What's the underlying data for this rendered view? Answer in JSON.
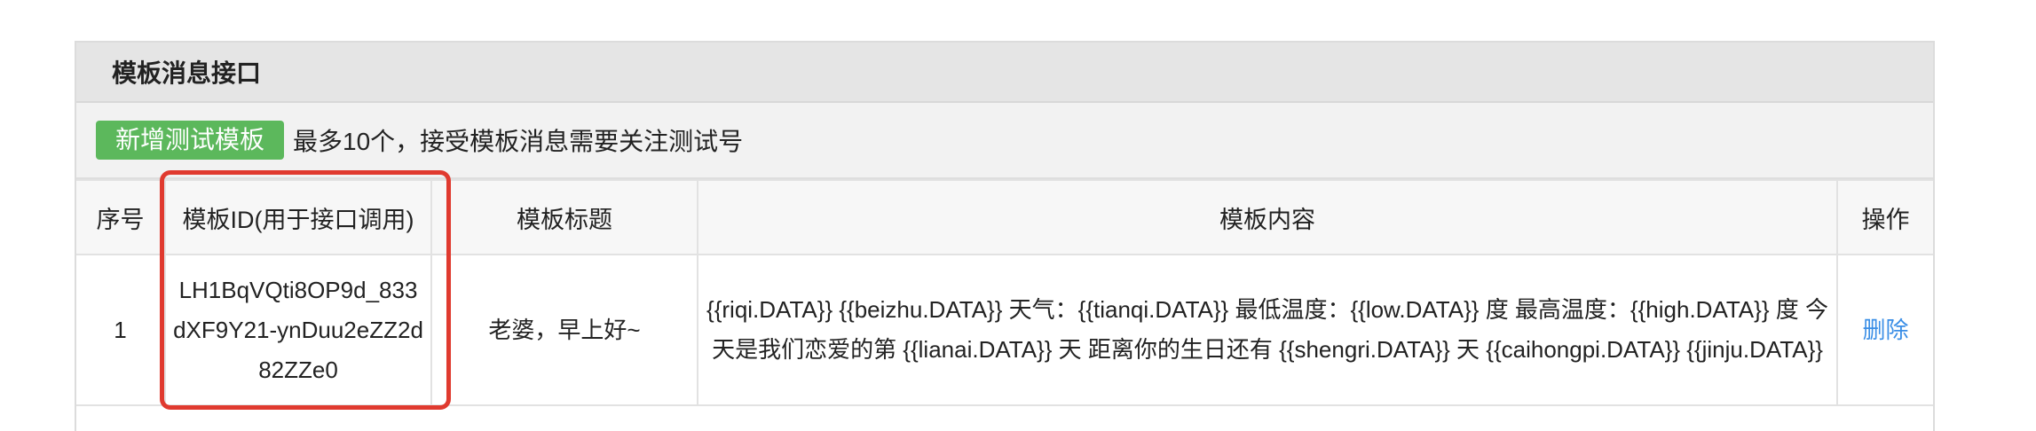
{
  "panel": {
    "title": "模板消息接口"
  },
  "toolbar": {
    "add_button_label": "新增测试模板",
    "note": "最多10个，接受模板消息需要关注测试号"
  },
  "table": {
    "headers": {
      "index": "序号",
      "template_id": "模板ID(用于接口调用)",
      "title": "模板标题",
      "content": "模板内容",
      "actions": "操作"
    },
    "rows": [
      {
        "index": "1",
        "template_id": "LH1BqVQti8OP9d_833dXF9Y21-ynDuu2eZZ2d82ZZe0",
        "title": "老婆，早上好~",
        "content": "{{riqi.DATA}} {{beizhu.DATA}} 天气：{{tianqi.DATA}} 最低温度：{{low.DATA}} 度 最高温度：{{high.DATA}} 度 今天是我们恋爱的第 {{lianai.DATA}} 天 距离你的生日还有 {{shengri.DATA}} 天 {{caihongpi.DATA}} {{jinju.DATA}}",
        "delete_label": "删除"
      }
    ]
  },
  "colors": {
    "header_bg": "#e5e5e5",
    "toolbar_bg": "#f2f2f2",
    "add_button_bg": "#5cb85c",
    "link": "#3a8ee6",
    "highlight": "#e03a2f"
  }
}
